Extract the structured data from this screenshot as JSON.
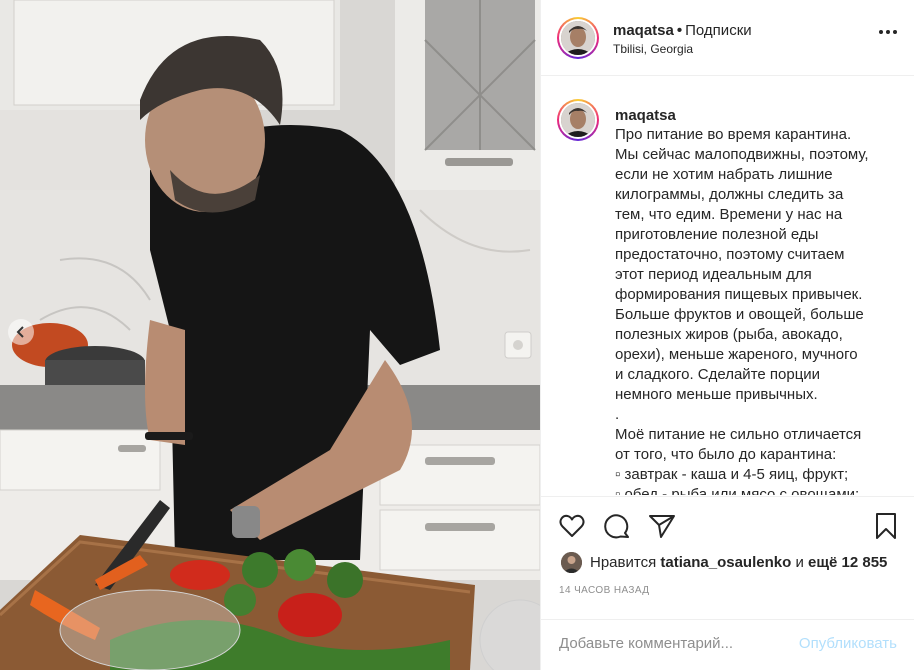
{
  "post": {
    "username": "maqatsa",
    "separator": "•",
    "follow_label": "Подписки",
    "location": "Tbilisi, Georgia"
  },
  "caption": {
    "username": "maqatsa",
    "lines": [
      "Про питание во время карантина.",
      "Мы сейчас малоподвижны, поэтому,",
      "если не хотим набрать лишние",
      "килограммы, должны следить за",
      "тем, что едим. Времени у нас на",
      "приготовление полезной еды",
      "предостаточно, поэтому считаем",
      "этот период идеальным для",
      "формирования пищевых привычек.",
      "Больше фруктов и овощей, больше",
      "полезных жиров (рыба, авокадо,",
      "орехи), меньше жареного, мучного",
      "и сладкого. Сделайте порции",
      "немного меньше привычных.",
      ".",
      "Моё питание не сильно отличается",
      "от того, что было до карантина:",
      "▫ завтрак - каша и 4-5 яиц, фрукт;",
      "▫ обед - рыба или мясо с овощами;"
    ]
  },
  "likes": {
    "prefix": "Нравится",
    "user": "tatiana_osaulenko",
    "middle": "и",
    "rest": "ещё 12 855"
  },
  "timestamp": "14 ЧАСОВ НАЗАД",
  "comment": {
    "placeholder": "Добавьте комментарий...",
    "publish_label": "Опубликовать"
  },
  "icons": [
    "more-options-icon",
    "heart-icon",
    "comment-icon",
    "share-icon",
    "bookmark-icon",
    "chevron-left-icon"
  ],
  "colors": {
    "text": "#262626",
    "secondary": "#8e8e8e",
    "publish_disabled": "#b2dffc",
    "border": "#efefef"
  }
}
